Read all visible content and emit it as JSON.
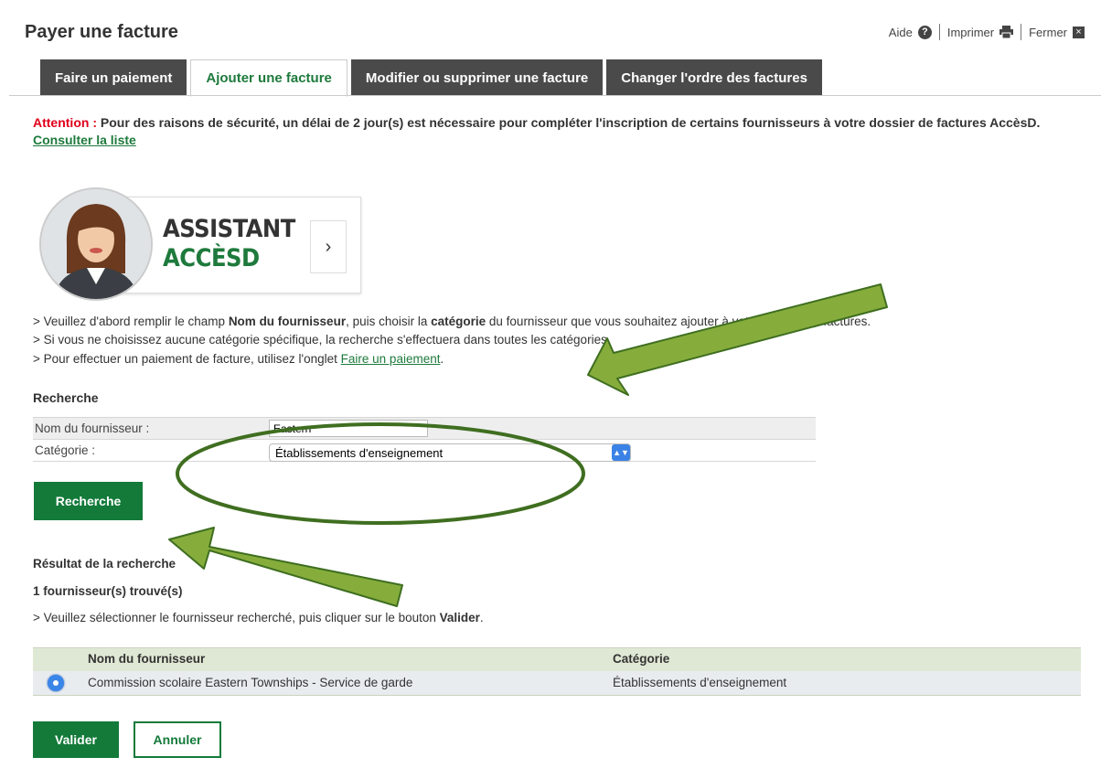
{
  "page": {
    "title": "Payer une facture"
  },
  "top_links": {
    "help": "Aide",
    "print": "Imprimer",
    "close": "Fermer"
  },
  "tabs": [
    {
      "label": "Faire un paiement",
      "active": false
    },
    {
      "label": "Ajouter une facture",
      "active": true
    },
    {
      "label": "Modifier ou supprimer une facture",
      "active": false
    },
    {
      "label": "Changer l'ordre des factures",
      "active": false
    }
  ],
  "attention": {
    "label": "Attention :",
    "text": " Pour des raisons de sécurité, un délai de 2 jour(s) est nécessaire pour compléter l'inscription de certains fournisseurs à votre dossier de factures AccèsD. ",
    "link": "Consulter la liste"
  },
  "assistant": {
    "line1": "ASSISTANT",
    "line2": "ACCÈSD",
    "arrow": "›"
  },
  "instructions": {
    "line1_a": "> Veuillez d'abord remplir le champ ",
    "line1_b": "Nom du fournisseur",
    "line1_c": ", puis choisir la ",
    "line1_d": "catégorie",
    "line1_e": " du fournisseur que vous souhaitez ajouter à votre dossier de factures.",
    "line2": "> Si vous ne choisissez aucune catégorie spécifique, la recherche s'effectuera dans toutes les catégories.",
    "line3_a": "> Pour effectuer un paiement de facture, utilisez l'onglet ",
    "line3_link": "Faire un paiement",
    "line3_b": "."
  },
  "search": {
    "heading": "Recherche",
    "name_label": "Nom du fournisseur :",
    "name_value": "Eastern",
    "category_label": "Catégorie :",
    "category_value": "Établissements d'enseignement",
    "button": "Recherche"
  },
  "results": {
    "heading": "Résultat de la recherche",
    "count": "1 fournisseur(s) trouvé(s)",
    "instr_a": "> Veuillez sélectionner le fournisseur recherché, puis cliquer sur le bouton ",
    "instr_b": "Valider",
    "instr_c": ".",
    "columns": [
      "Nom du fournisseur",
      "Catégorie"
    ],
    "rows": [
      {
        "name": "Commission scolaire Eastern Townships - Service de garde",
        "category": "Établissements d'enseignement",
        "selected": true
      }
    ]
  },
  "actions": {
    "validate": "Valider",
    "cancel": "Annuler"
  },
  "colors": {
    "brand_green": "#137a3a",
    "attention_red": "#e0001b",
    "annotation_green": "#86ad3c",
    "annotation_outline": "#3f6e20"
  }
}
